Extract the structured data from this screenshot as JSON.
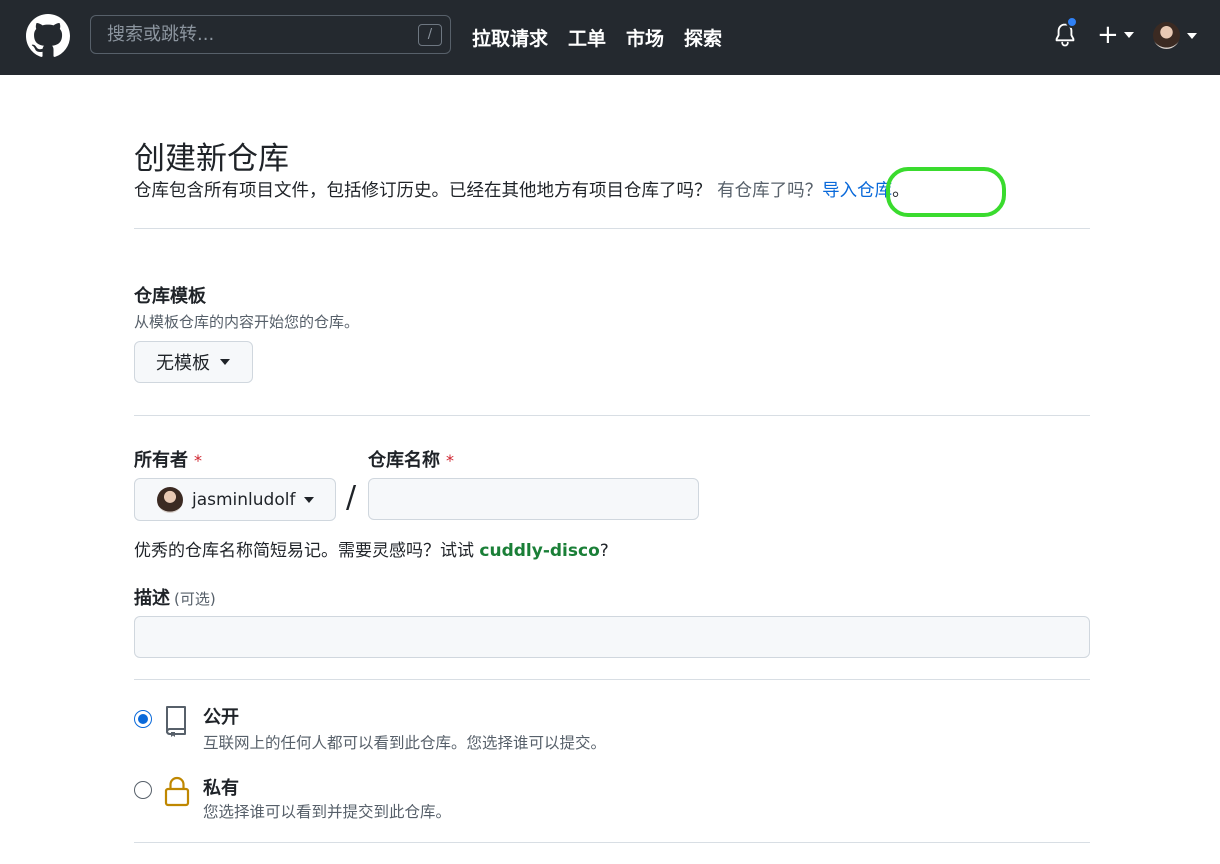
{
  "header": {
    "search_placeholder": "搜索或跳转...",
    "search_shortcut": "/",
    "nav": [
      "拉取请求",
      "工单",
      "市场",
      "探索"
    ],
    "plus_label": "+",
    "notification_dot_color": "#2f81f7"
  },
  "page": {
    "title": "创建新仓库",
    "subtitle": "仓库包含所有项目文件，包括修订历史。已经在其他地方有项目仓库了吗？",
    "have_repo": "有仓库了吗？",
    "import_link": "导入仓库",
    "import_suffix": "。",
    "highlight_color": "#3adb2e"
  },
  "template": {
    "label": "仓库模板",
    "hint": "从模板仓库的内容开始您的仓库。",
    "button": "无模板"
  },
  "owner": {
    "label": "所有者",
    "required": "*",
    "value": "jasminludolf"
  },
  "repo_name": {
    "label": "仓库名称",
    "required": "*",
    "separator": "/",
    "value": ""
  },
  "name_hint": {
    "text": "优秀的仓库名称简短易记。需要灵感吗？试试 ",
    "suggestion": "cuddly-disco",
    "suffix": "?"
  },
  "description": {
    "label": "描述",
    "optional": "(可选)",
    "value": ""
  },
  "visibility": {
    "selected": "public",
    "options": [
      {
        "title": "公开",
        "desc": "互联网上的任何人都可以看到此仓库。您选择谁可以提交。",
        "icon": "repo-icon"
      },
      {
        "title": "私有",
        "desc": "您选择谁可以看到并提交到此仓库。",
        "icon": "lock-icon"
      }
    ]
  }
}
